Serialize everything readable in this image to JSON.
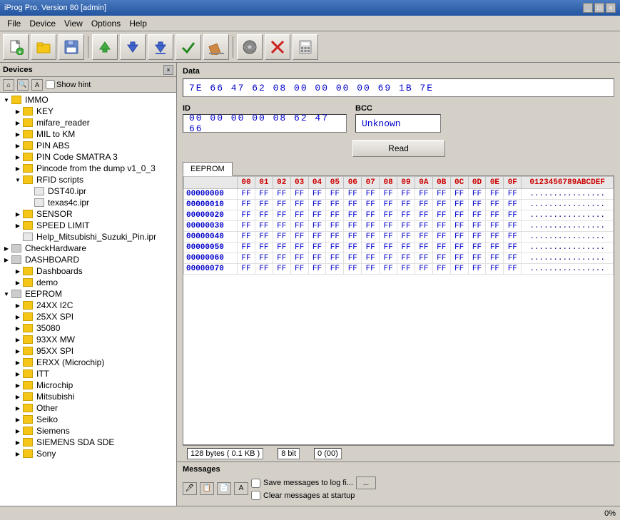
{
  "titleBar": {
    "title": "iProg Pro. Version 80 [admin]",
    "controls": [
      "_",
      "□",
      "×"
    ]
  },
  "menuBar": {
    "items": [
      "File",
      "Device",
      "View",
      "Options",
      "Help"
    ]
  },
  "toolbar": {
    "buttons": [
      {
        "name": "new",
        "icon": "📄"
      },
      {
        "name": "open",
        "icon": "📂"
      },
      {
        "name": "save",
        "icon": "💾"
      },
      {
        "name": "upload",
        "icon": "⬆"
      },
      {
        "name": "download",
        "icon": "⬇"
      },
      {
        "name": "download2",
        "icon": "⬇"
      },
      {
        "name": "check",
        "icon": "✔"
      },
      {
        "name": "clear",
        "icon": "🖌"
      },
      {
        "name": "disk",
        "icon": "💿"
      },
      {
        "name": "stop",
        "icon": "✖"
      },
      {
        "name": "calc",
        "icon": "🧮"
      }
    ]
  },
  "devicesPanel": {
    "title": "Devices",
    "showHint": "Show hint",
    "tree": [
      {
        "label": "IMMO",
        "type": "folder",
        "indent": 0,
        "expanded": true
      },
      {
        "label": "KEY",
        "type": "folder",
        "indent": 1
      },
      {
        "label": "mifare_reader",
        "type": "folder",
        "indent": 1
      },
      {
        "label": "MIL to KM",
        "type": "folder",
        "indent": 1
      },
      {
        "label": "PIN ABS",
        "type": "folder",
        "indent": 1
      },
      {
        "label": "PIN Code SMATRA 3",
        "type": "folder",
        "indent": 1
      },
      {
        "label": "Pincode from the dump v1_0_3",
        "type": "folder",
        "indent": 1
      },
      {
        "label": "RFID scripts",
        "type": "folder",
        "indent": 1,
        "expanded": true
      },
      {
        "label": "DST40.ipr",
        "type": "file",
        "indent": 2
      },
      {
        "label": "texas4c.ipr",
        "type": "file",
        "indent": 2
      },
      {
        "label": "SENSOR",
        "type": "folder",
        "indent": 1
      },
      {
        "label": "SPEED LIMIT",
        "type": "folder",
        "indent": 1
      },
      {
        "label": "Help_Mitsubishi_Suzuki_Pin.ipr",
        "type": "file",
        "indent": 1
      },
      {
        "label": "CheckHardware",
        "type": "item",
        "indent": 0
      },
      {
        "label": "DASHBOARD",
        "type": "item",
        "indent": 0
      },
      {
        "label": "Dashboards",
        "type": "folder",
        "indent": 1
      },
      {
        "label": "demo",
        "type": "folder",
        "indent": 1
      },
      {
        "label": "EEPROM",
        "type": "item",
        "indent": 0,
        "expanded": true
      },
      {
        "label": "24XX I2C",
        "type": "folder",
        "indent": 1
      },
      {
        "label": "25XX SPI",
        "type": "folder",
        "indent": 1
      },
      {
        "label": "35080",
        "type": "folder",
        "indent": 1
      },
      {
        "label": "93XX MW",
        "type": "folder",
        "indent": 1
      },
      {
        "label": "95XX SPI",
        "type": "folder",
        "indent": 1
      },
      {
        "label": "ERXX (Microchip)",
        "type": "folder",
        "indent": 1
      },
      {
        "label": "ITT",
        "type": "folder",
        "indent": 1
      },
      {
        "label": "Microchip",
        "type": "folder",
        "indent": 1
      },
      {
        "label": "Mitsubishi",
        "type": "folder",
        "indent": 1
      },
      {
        "label": "Other",
        "type": "folder",
        "indent": 1
      },
      {
        "label": "Seiko",
        "type": "folder",
        "indent": 1
      },
      {
        "label": "Siemens",
        "type": "folder",
        "indent": 1
      },
      {
        "label": "SIEMENS SDA SDE",
        "type": "folder",
        "indent": 1
      },
      {
        "label": "Sony",
        "type": "folder",
        "indent": 1
      }
    ]
  },
  "dataSection": {
    "label": "Data",
    "value": "7E 66 47 62 08 00 00 00 00 69 1B 7E"
  },
  "idSection": {
    "label": "ID",
    "value": "00 00 00 00 08 62 47 66"
  },
  "bccSection": {
    "label": "BCC",
    "value": "Unknown"
  },
  "readButton": {
    "label": "Read"
  },
  "eepromTab": {
    "label": "EEPROM",
    "headers": [
      "",
      "00",
      "01",
      "02",
      "03",
      "04",
      "05",
      "06",
      "07",
      "08",
      "09",
      "0A",
      "0B",
      "0C",
      "0D",
      "0E",
      "0F",
      "0123456789ABCDEF"
    ],
    "rows": [
      {
        "addr": "00000000",
        "vals": [
          "FF",
          "FF",
          "FF",
          "FF",
          "FF",
          "FF",
          "FF",
          "FF",
          "FF",
          "FF",
          "FF",
          "FF",
          "FF",
          "FF",
          "FF",
          "FF"
        ],
        "ascii": "................"
      },
      {
        "addr": "00000010",
        "vals": [
          "FF",
          "FF",
          "FF",
          "FF",
          "FF",
          "FF",
          "FF",
          "FF",
          "FF",
          "FF",
          "FF",
          "FF",
          "FF",
          "FF",
          "FF",
          "FF"
        ],
        "ascii": "................"
      },
      {
        "addr": "00000020",
        "vals": [
          "FF",
          "FF",
          "FF",
          "FF",
          "FF",
          "FF",
          "FF",
          "FF",
          "FF",
          "FF",
          "FF",
          "FF",
          "FF",
          "FF",
          "FF",
          "FF"
        ],
        "ascii": "................"
      },
      {
        "addr": "00000030",
        "vals": [
          "FF",
          "FF",
          "FF",
          "FF",
          "FF",
          "FF",
          "FF",
          "FF",
          "FF",
          "FF",
          "FF",
          "FF",
          "FF",
          "FF",
          "FF",
          "FF"
        ],
        "ascii": "................"
      },
      {
        "addr": "00000040",
        "vals": [
          "FF",
          "FF",
          "FF",
          "FF",
          "FF",
          "FF",
          "FF",
          "FF",
          "FF",
          "FF",
          "FF",
          "FF",
          "FF",
          "FF",
          "FF",
          "FF"
        ],
        "ascii": "................"
      },
      {
        "addr": "00000050",
        "vals": [
          "FF",
          "FF",
          "FF",
          "FF",
          "FF",
          "FF",
          "FF",
          "FF",
          "FF",
          "FF",
          "FF",
          "FF",
          "FF",
          "FF",
          "FF",
          "FF"
        ],
        "ascii": "................"
      },
      {
        "addr": "00000060",
        "vals": [
          "FF",
          "FF",
          "FF",
          "FF",
          "FF",
          "FF",
          "FF",
          "FF",
          "FF",
          "FF",
          "FF",
          "FF",
          "FF",
          "FF",
          "FF",
          "FF"
        ],
        "ascii": "................"
      },
      {
        "addr": "00000070",
        "vals": [
          "FF",
          "FF",
          "FF",
          "FF",
          "FF",
          "FF",
          "FF",
          "FF",
          "FF",
          "FF",
          "FF",
          "FF",
          "FF",
          "FF",
          "FF",
          "FF"
        ],
        "ascii": "................"
      }
    ],
    "statusItems": [
      "128 bytes ( 0.1 KB )",
      "8 bit",
      "0 (00)"
    ]
  },
  "messagesPanel": {
    "title": "Messages",
    "options": [
      {
        "label": "Save messages to log fi...",
        "checked": false
      },
      {
        "label": "Clear messages at startup",
        "checked": false
      }
    ],
    "browseLabel": "..."
  },
  "statusBar": {
    "progress": "0%"
  }
}
